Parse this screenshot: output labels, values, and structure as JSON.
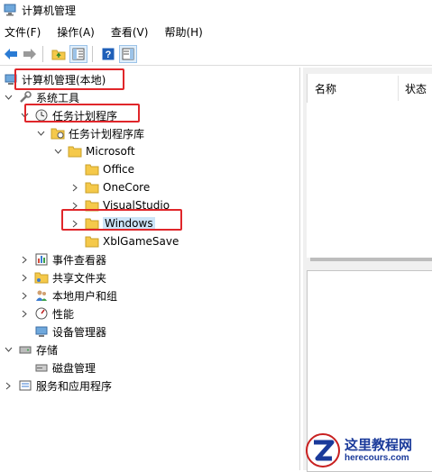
{
  "window": {
    "title": "计算机管理"
  },
  "menubar": {
    "items": [
      "文件(F)",
      "操作(A)",
      "查看(V)",
      "帮助(H)"
    ]
  },
  "tree": {
    "root": "计算机管理(本地)",
    "system_tools": "系统工具",
    "task_scheduler": "任务计划程序",
    "task_library": "任务计划程序库",
    "microsoft": "Microsoft",
    "office": "Office",
    "onecore": "OneCore",
    "visualstudio": "VisualStudio",
    "windows": "Windows",
    "xblgamesave": "XblGameSave",
    "event_viewer": "事件查看器",
    "shared_folders": "共享文件夹",
    "local_users": "本地用户和组",
    "performance": "性能",
    "device_manager": "设备管理器",
    "storage": "存储",
    "disk_management": "磁盘管理",
    "services_apps": "服务和应用程序"
  },
  "list": {
    "columns": [
      "名称",
      "状态"
    ]
  },
  "watermark": {
    "cn": "这里教程网",
    "en": "herecours.com"
  },
  "colors": {
    "highlight": "#e0262a",
    "selection": "#cce4f7",
    "folder": "#f5c94a"
  }
}
